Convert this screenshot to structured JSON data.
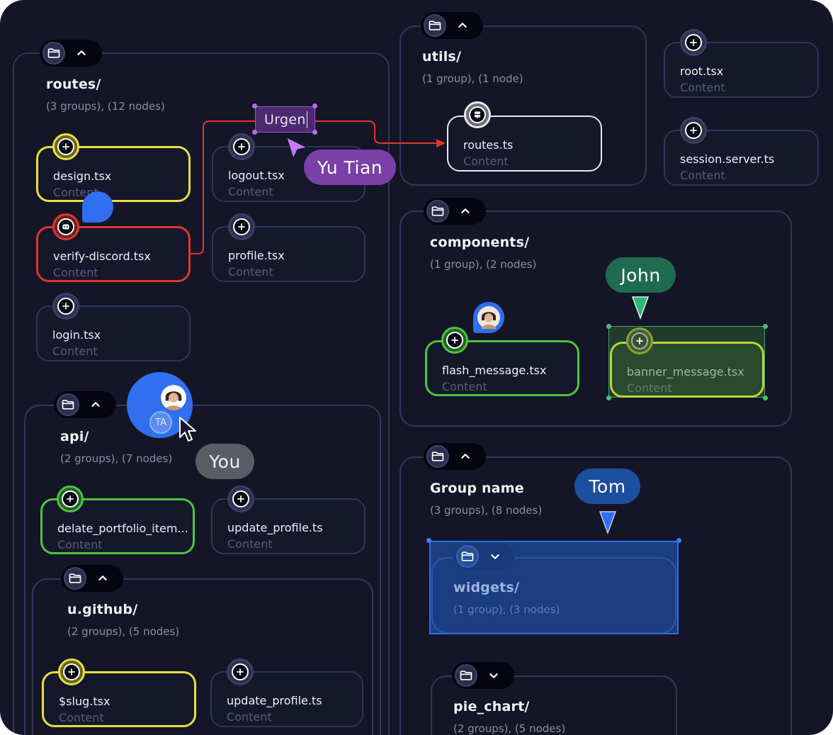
{
  "groups": {
    "routes": {
      "title": "routes/",
      "meta": "(3 groups), (12 nodes)"
    },
    "api": {
      "title": "api/",
      "meta": "(2 groups), (7 nodes)"
    },
    "ugithub": {
      "title": "u.github/",
      "meta": "(2 groups), (5 nodes)"
    },
    "utils": {
      "title": "utils/",
      "meta": "(1 group), (1 node)"
    },
    "components": {
      "title": "components/",
      "meta": "(1 group), (2 nodes)"
    },
    "groupname": {
      "title": "Group name",
      "meta": "(3 groups), (8 nodes)"
    },
    "widgets": {
      "title": "widgets/",
      "meta": "(1 group), (3 nodes)"
    },
    "piechart": {
      "title": "pie_chart/",
      "meta": "(2 groups), (5 nodes)"
    }
  },
  "nodes": {
    "design": {
      "name": "design.tsx",
      "content": "Content"
    },
    "logout": {
      "name": "logout.tsx",
      "content": "Content"
    },
    "verify": {
      "name": "verify-discord.tsx",
      "content": "Content"
    },
    "profile": {
      "name": "profile.tsx",
      "content": "Content"
    },
    "login": {
      "name": "login.tsx",
      "content": "Content"
    },
    "delate": {
      "name": "delate_portfolio_item...",
      "content": "Content"
    },
    "update1": {
      "name": "update_profile.ts",
      "content": "Content"
    },
    "slug": {
      "name": "$slug.tsx",
      "content": "Content"
    },
    "update2": {
      "name": "update_profile.ts",
      "content": "Content"
    },
    "routests": {
      "name": "routes.ts",
      "content": "Content"
    },
    "root": {
      "name": "root.tsx",
      "content": "Content"
    },
    "session": {
      "name": "session.server.ts",
      "content": "Content"
    },
    "flash": {
      "name": "flash_message.tsx",
      "content": "Content"
    },
    "banner": {
      "name": "banner_message.tsx",
      "content": "Content"
    }
  },
  "edge_label": {
    "text": "Urgen"
  },
  "cursors": {
    "yutian": {
      "label": "Yu Tian",
      "color": "#7b3fa8"
    },
    "john": {
      "label": "John",
      "color": "#1f6b4f"
    },
    "tom": {
      "label": "Tom",
      "color": "#1d4fa0"
    },
    "you": {
      "label": "You",
      "color": "#5a5d66"
    }
  },
  "presence": {
    "initials": "TA"
  },
  "colors": {
    "background": "#141628",
    "yellow": "#e8df3c",
    "red": "#e0362c",
    "green": "#4cc63a",
    "purple": "#a64ee0",
    "blue": "#2563eb"
  },
  "icons": {
    "folder": "folder-icon",
    "chevron_up": "chevron-up-icon",
    "chevron_down": "chevron-down-icon",
    "plus": "plus-icon",
    "discord": "discord-icon",
    "server": "server-icon",
    "pointer": "mouse-pointer-icon"
  }
}
